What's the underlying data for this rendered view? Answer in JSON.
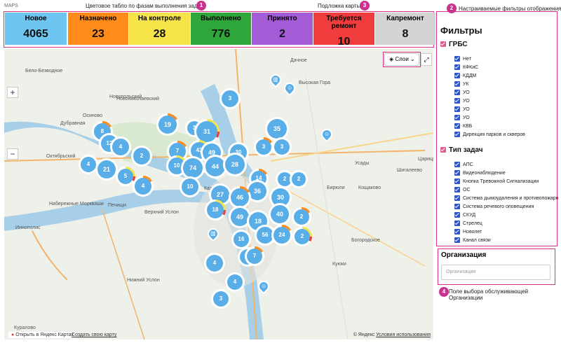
{
  "app_label": "MAPS",
  "annotations": [
    {
      "num": "1",
      "text": "Цветовое табло по фазам выполнения задач"
    },
    {
      "num": "2",
      "text": "Настраиваемые фильтры отображения"
    },
    {
      "num": "3",
      "text": "Подложка карты"
    },
    {
      "num": "4",
      "text": "Поле выбора обслуживающей Организации"
    }
  ],
  "phases": [
    {
      "label": "Новое",
      "value": "4065",
      "color": "#6ec6f0"
    },
    {
      "label": "Назначено",
      "value": "23",
      "color": "#ff8c1a"
    },
    {
      "label": "На контроле",
      "value": "28",
      "color": "#f7e44a"
    },
    {
      "label": "Выполнено",
      "value": "776",
      "color": "#2ea63a"
    },
    {
      "label": "Принято",
      "value": "2",
      "color": "#a35bd6"
    },
    {
      "label": "Требуется ремонт",
      "value": "10",
      "color": "#f03c3c"
    },
    {
      "label": "Капремонт",
      "value": "8",
      "color": "#d4d4d4"
    }
  ],
  "map": {
    "layers_label": "Слои",
    "open_yandex": "Открыть в Яндекс Картах",
    "create_map": "Создать свою карту",
    "copyright": "© Яндекс",
    "terms": "Условия использования",
    "labels": [
      "Бело-Безводное",
      "Дубравная",
      "Осиново",
      "Новопольский",
      "Новониколаевский",
      "Октябрьский",
      "Набережные Моркваши",
      "Печищи",
      "Верхний Услон",
      "Иннополис",
      "Нижний Услон",
      "Куралово",
      "Высокая Гора",
      "Дачное",
      "Бирюли",
      "Усады",
      "Шигалеево",
      "Царицыно",
      "Кощаково",
      "Богородское",
      "Куюки",
      "Каз"
    ],
    "clusters": [
      "3",
      "19",
      "3",
      "31",
      "35",
      "8",
      "12",
      "4",
      "2",
      "7",
      "43",
      "49",
      "30",
      "3",
      "3",
      "4",
      "21",
      "10",
      "74",
      "44",
      "28",
      "14",
      "2",
      "2",
      "5",
      "4",
      "10",
      "36",
      "27",
      "46",
      "30",
      "18",
      "40",
      "2",
      "49",
      "18",
      "56",
      "24",
      "2",
      "16",
      "6",
      "7",
      "4",
      "4",
      "3"
    ]
  },
  "filters": {
    "title": "Фильтры",
    "groups": [
      {
        "label": "ГРБС",
        "items": [
          "Нет",
          "КФКиС",
          "КДДМ",
          "УК",
          "УО",
          "УО",
          "УО",
          "УО",
          "КВБ",
          "Дирекция парков и скверов"
        ]
      },
      {
        "label": "Тип задач",
        "items": [
          "АПС",
          "Видеонаблюдение",
          "Кнопка Тревожной Сигнализации",
          "ОС",
          "Система дымоудаления и противопожарн",
          "Система речевого оповещения",
          "СКУД",
          "Стрелец",
          "Новолет",
          "Канал связи"
        ]
      }
    ]
  },
  "organization": {
    "title": "Организация",
    "placeholder": "Организация"
  }
}
